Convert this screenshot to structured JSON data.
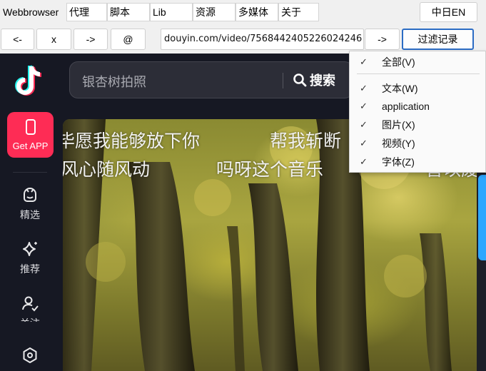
{
  "menubar": {
    "items": [
      "Webbrowser",
      "代理",
      "脚本",
      "Lib",
      "资源",
      "多媒体",
      "关于"
    ],
    "lang_button": "中日EN"
  },
  "toolbar": {
    "back": "<-",
    "stop": "x",
    "forward": "->",
    "at": "@",
    "url": "douyin.com/video/7568442405226024246",
    "go": "->",
    "filter": "过滤记录"
  },
  "filter_menu": {
    "items": [
      {
        "label": "全部(V)",
        "checked": "✓"
      },
      {
        "label": "文本(W)",
        "checked": "✓"
      },
      {
        "label": "application",
        "checked": "✓"
      },
      {
        "label": "图片(X)",
        "checked": "✓"
      },
      {
        "label": "视频(Y)",
        "checked": "✓"
      },
      {
        "label": "字体(Z)",
        "checked": "✓"
      }
    ]
  },
  "page": {
    "search_placeholder": "银杏树拍照",
    "search_button": "搜索",
    "get_app": "Get APP",
    "nav": [
      {
        "label": "精选",
        "icon": "featured-icon"
      },
      {
        "label": "推荐",
        "icon": "sparkle-icon"
      },
      {
        "label": "关注",
        "icon": "follow-icon"
      },
      {
        "label": "",
        "icon": "hexagon-icon"
      }
    ],
    "lyrics": {
      "line1_a": "毕愿我能够放下你",
      "line1_b": "帮我斩断",
      "line2_a": "风心随风动",
      "line2_b": "吗呀这个音乐",
      "line2_c": "音以废"
    }
  },
  "colors": {
    "accent": "#fe2c55",
    "page_bg": "#161823",
    "focus": "#2b6cc4",
    "scroll_handle": "#2ea7ff"
  }
}
